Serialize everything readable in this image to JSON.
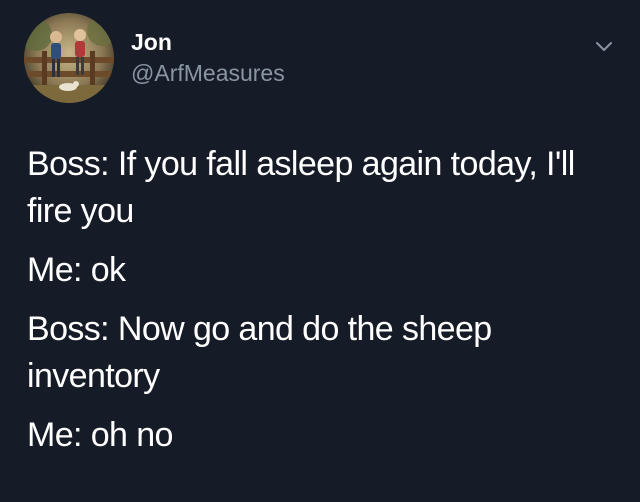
{
  "author": {
    "name": "Jon",
    "handle": "@ArfMeasures",
    "avatar_icon": "profile-photo-avatar"
  },
  "menu": {
    "icon": "chevron-down-icon"
  },
  "tweet": {
    "paragraphs": [
      "Boss: If you fall asleep again today, I'll fire you",
      "Me: ok",
      "Boss: Now go and do the sheep inventory",
      "Me: oh no"
    ]
  },
  "colors": {
    "background": "#161c27",
    "text": "#ffffff",
    "secondary_text": "#8a95a3"
  }
}
